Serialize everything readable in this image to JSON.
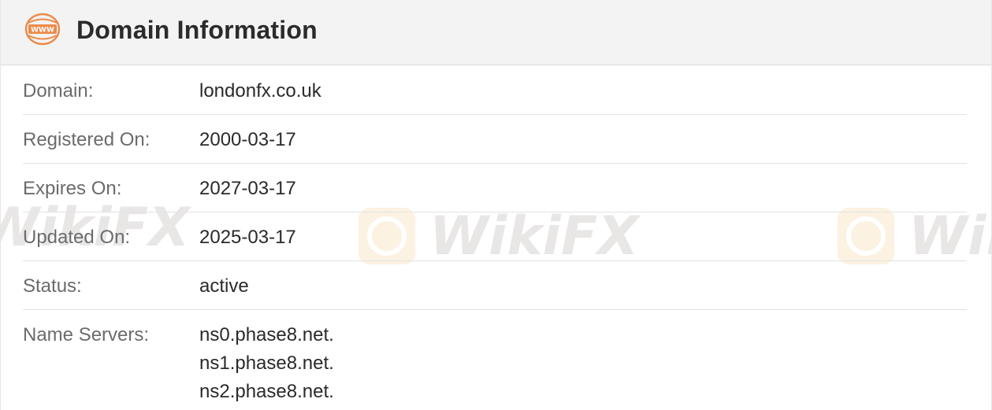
{
  "header": {
    "title": "Domain Information",
    "icon": "www-icon",
    "icon_text": "WWW",
    "accent_color": "#ec8a4a"
  },
  "rows": [
    {
      "label": "Domain:",
      "value": "londonfx.co.uk"
    },
    {
      "label": "Registered On:",
      "value": "2000-03-17"
    },
    {
      "label": "Expires On:",
      "value": "2027-03-17"
    },
    {
      "label": "Updated On:",
      "value": "2025-03-17"
    },
    {
      "label": "Status:",
      "value": "active"
    }
  ],
  "name_servers": {
    "label": "Name Servers:",
    "values": [
      "ns0.phase8.net.",
      "ns1.phase8.net.",
      "ns2.phase8.net."
    ]
  },
  "watermark": {
    "text": "WikiFX",
    "color": "#7a6a6a",
    "logo_color": "#f2b24a"
  }
}
